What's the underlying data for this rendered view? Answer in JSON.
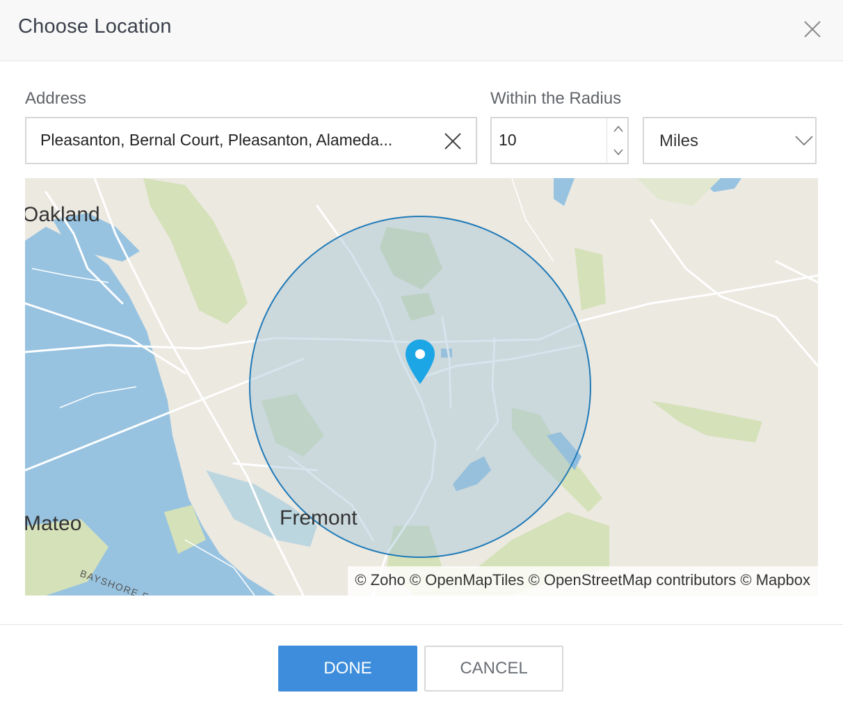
{
  "dialog": {
    "title": "Choose Location",
    "close_icon": "close-icon"
  },
  "address": {
    "label": "Address",
    "value": "Pleasanton, Bernal Court, Pleasanton, Alameda...",
    "clear_icon": "clear-x-icon"
  },
  "radius": {
    "label": "Within the Radius",
    "value": "10",
    "up_icon": "chevron-up-icon",
    "down_icon": "chevron-down-icon"
  },
  "unit": {
    "value": "Miles",
    "icon": "chevron-down-icon"
  },
  "map": {
    "place_labels": {
      "oakland": "Oakland",
      "fremont": "Fremont",
      "san_mateo": "Mateo",
      "bayshore": "BAYSHORE F"
    },
    "marker_icon": "map-pin-icon",
    "attribution": "© Zoho © OpenMapTiles © OpenStreetMap contributors © Mapbox",
    "colors": {
      "water": "#97c3e1",
      "land": "#ece9e1",
      "park": "#d5e1b8",
      "radius_stroke": "#1f7ab8",
      "pin": "#1da6e6"
    }
  },
  "footer": {
    "done_label": "DONE",
    "cancel_label": "CANCEL"
  }
}
